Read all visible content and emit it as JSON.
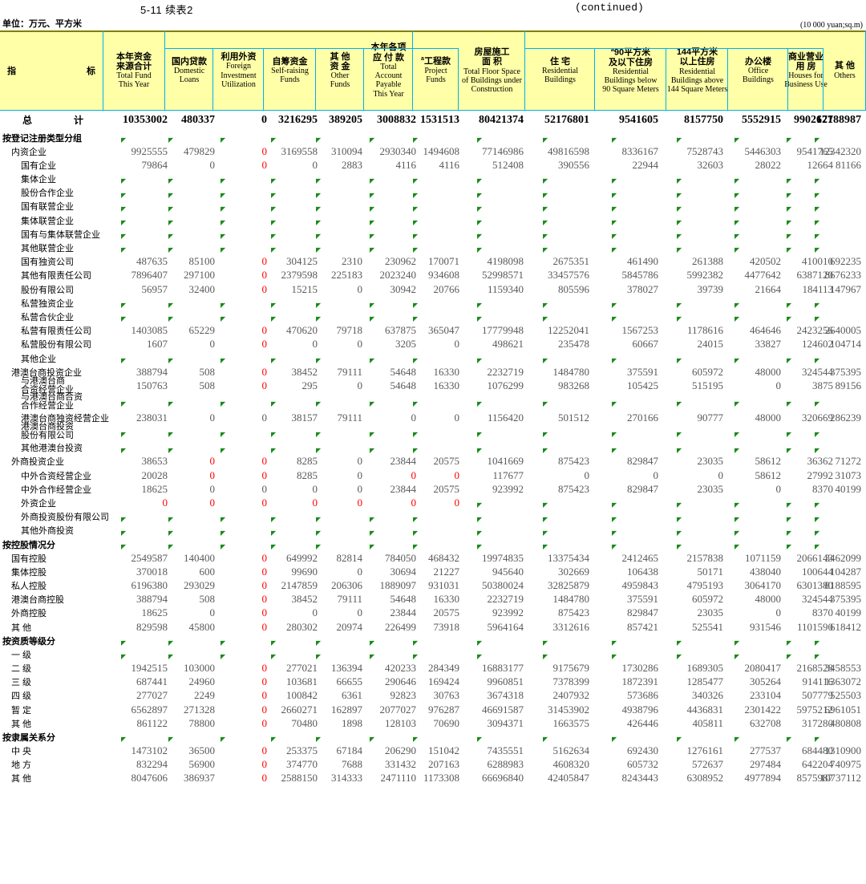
{
  "caption": {
    "table_number": "5-11  续表2",
    "continued": "(continued)",
    "unit_cn": "单位：万元、平方米",
    "unit_en": "(10 000 yuan;sq.m)"
  },
  "stub_header": {
    "left": "指",
    "right": "标"
  },
  "colors": {
    "header_bg": "#ffffa8",
    "grid": "#00b0f0",
    "top_rule": "#808000",
    "value": "#595959",
    "zero_red": "#ff0000",
    "tick": "#1a8a1a"
  },
  "columns": [
    {
      "key": "total_fund",
      "cn": "本年资金\n来源合计",
      "en": "Total Fund\nThis Year"
    },
    {
      "key": "domestic_loans",
      "cn": "国内贷款",
      "en": "Domestic\nLoans"
    },
    {
      "key": "foreign_inv",
      "cn": "利用外资",
      "en": "Foreign\nInvestment\nUtilization"
    },
    {
      "key": "self_raising",
      "cn": "自筹资金",
      "en": "Self-raising\nFunds"
    },
    {
      "key": "other_funds",
      "cn": "其  他\n资  金",
      "en": "Other\nFunds"
    },
    {
      "key": "account_payable",
      "cn": "本年各项\n应 付 款",
      "en": "Total\nAccount\nPayable\nThis Year"
    },
    {
      "key": "project_funds",
      "cn": "工程款",
      "en": "Project\nFunds",
      "sup": "a"
    },
    {
      "key": "total_floor",
      "cn": "房屋施工\n面     积",
      "en": "Total Floor Space\nof Buildings under\nConstruction"
    },
    {
      "key": "residential",
      "cn": "住   宅",
      "en": "Residential\nBuildings"
    },
    {
      "key": "res_below90",
      "cn": "90平方米\n及以下住房",
      "en": "Residential\nBuildings below\n90 Square Meters",
      "sup": "a"
    },
    {
      "key": "res_above144",
      "cn": "144平方米\n以上住房",
      "en": "Residential\nBuildings above\n144 Square Meters"
    },
    {
      "key": "office",
      "cn": "办公楼",
      "en": "Office\nBuildings"
    },
    {
      "key": "business",
      "cn": "商业营业\n用    房",
      "en": "Houses for\nBusiness Use"
    },
    {
      "key": "others",
      "cn": "其  他",
      "en": "Others"
    }
  ],
  "rows": [
    {
      "type": "total",
      "label": [
        "总",
        "计"
      ],
      "values": [
        "10353002",
        "480337",
        "0",
        "3216295",
        "389205",
        "3008832",
        "1531513",
        "80421374",
        "52176801",
        "9541605",
        "8157750",
        "5552915",
        "9902671",
        "12788987"
      ],
      "red": [
        2
      ]
    },
    {
      "type": "group",
      "label": "按登记注册类型分组",
      "values": []
    },
    {
      "type": "data",
      "indent": 1,
      "label": "内资企业",
      "values": [
        "9925555",
        "479829",
        "0",
        "3169558",
        "310094",
        "2930340",
        "1494608",
        "77146986",
        "49816598",
        "8336167",
        "7528743",
        "5446303",
        "9541765",
        "12342320"
      ],
      "red": [
        2
      ]
    },
    {
      "type": "data",
      "indent": 2,
      "label": "国有企业",
      "values": [
        "79864",
        "0",
        "0",
        "0",
        "2883",
        "4116",
        "4116",
        "512408",
        "390556",
        "22944",
        "32603",
        "28022",
        "12664",
        "81166"
      ],
      "red": [
        2
      ]
    },
    {
      "type": "data",
      "indent": 2,
      "label": "集体企业",
      "values": []
    },
    {
      "type": "data",
      "indent": 2,
      "label": "股份合作企业",
      "values": []
    },
    {
      "type": "data",
      "indent": 2,
      "label": "国有联营企业",
      "values": []
    },
    {
      "type": "data",
      "indent": 2,
      "label": "集体联营企业",
      "values": []
    },
    {
      "type": "data",
      "indent": 2,
      "label": "国有与集体联营企业",
      "values": []
    },
    {
      "type": "data",
      "indent": 2,
      "label": "其他联营企业",
      "values": []
    },
    {
      "type": "data",
      "indent": 2,
      "label": "国有独资公司",
      "values": [
        "487635",
        "85100",
        "0",
        "304125",
        "2310",
        "230962",
        "170071",
        "4198098",
        "2675351",
        "461490",
        "261388",
        "420502",
        "410010",
        "692235"
      ],
      "red": [
        2
      ]
    },
    {
      "type": "data",
      "indent": 2,
      "label": "其他有限责任公司",
      "values": [
        "7896407",
        "297100",
        "0",
        "2379598",
        "225183",
        "2023240",
        "934608",
        "52998571",
        "33457576",
        "5845786",
        "5992382",
        "4477642",
        "6387120",
        "8676233"
      ],
      "red": [
        2
      ]
    },
    {
      "type": "data",
      "indent": 2,
      "label": "股份有限公司",
      "values": [
        "56957",
        "32400",
        "0",
        "15215",
        "0",
        "30942",
        "20766",
        "1159340",
        "805596",
        "378027",
        "39739",
        "21664",
        "184113",
        "147967"
      ],
      "red": [
        2
      ]
    },
    {
      "type": "data",
      "indent": 2,
      "label": "私营独资企业",
      "values": []
    },
    {
      "type": "data",
      "indent": 2,
      "label": "私营合伙企业",
      "values": []
    },
    {
      "type": "data",
      "indent": 2,
      "label": "私营有限责任公司",
      "values": [
        "1403085",
        "65229",
        "0",
        "470620",
        "79718",
        "637875",
        "365047",
        "17779948",
        "12252041",
        "1567253",
        "1178616",
        "464646",
        "2423256",
        "2640005"
      ],
      "red": [
        2
      ]
    },
    {
      "type": "data",
      "indent": 2,
      "label": "私营股份有限公司",
      "values": [
        "1607",
        "0",
        "0",
        "0",
        "0",
        "3205",
        "0",
        "498621",
        "235478",
        "60667",
        "24015",
        "33827",
        "124602",
        "104714"
      ],
      "red": [
        2
      ]
    },
    {
      "type": "data",
      "indent": 2,
      "label": "其他企业",
      "values": []
    },
    {
      "type": "data",
      "indent": 1,
      "label": "港澳台商投资企业",
      "values": [
        "388794",
        "508",
        "0",
        "38452",
        "79111",
        "54648",
        "16330",
        "2232719",
        "1484780",
        "375591",
        "605972",
        "48000",
        "324544",
        "375395"
      ],
      "red": [
        2
      ]
    },
    {
      "type": "data",
      "indent": 2,
      "label2": [
        "与港澳台商",
        "合资经营企业"
      ],
      "values": [
        "150763",
        "508",
        "0",
        "295",
        "0",
        "54648",
        "16330",
        "1076299",
        "983268",
        "105425",
        "515195",
        "0",
        "3875",
        "89156"
      ],
      "red": [
        2
      ]
    },
    {
      "type": "data",
      "indent": 2,
      "label2": [
        "与港澳台商合资",
        "合作经营企业"
      ],
      "values": []
    },
    {
      "type": "data",
      "indent": 2,
      "label": "港澳台商独资经营企业",
      "values": [
        "238031",
        "0",
        "0",
        "38157",
        "79111",
        "0",
        "0",
        "1156420",
        "501512",
        "270166",
        "90777",
        "48000",
        "320669",
        "286239"
      ],
      "red": []
    },
    {
      "type": "data",
      "indent": 2,
      "label2": [
        "港澳台商投资",
        "股份有限公司"
      ],
      "values": []
    },
    {
      "type": "data",
      "indent": 2,
      "label": "其他港澳台投资",
      "values": []
    },
    {
      "type": "data",
      "indent": 1,
      "label": "外商投资企业",
      "values": [
        "38653",
        "0",
        "0",
        "8285",
        "0",
        "23844",
        "20575",
        "1041669",
        "875423",
        "829847",
        "23035",
        "58612",
        "36362",
        "71272"
      ],
      "red": [
        1,
        2
      ]
    },
    {
      "type": "data",
      "indent": 2,
      "label": "中外合资经营企业",
      "values": [
        "20028",
        "0",
        "0",
        "8285",
        "0",
        "0",
        "0",
        "117677",
        "0",
        "0",
        "0",
        "58612",
        "27992",
        "31073"
      ],
      "red": [
        1,
        2,
        5,
        6
      ]
    },
    {
      "type": "data",
      "indent": 2,
      "label": "中外合作经营企业",
      "values": [
        "18625",
        "0",
        "0",
        "0",
        "0",
        "23844",
        "20575",
        "923992",
        "875423",
        "829847",
        "23035",
        "0",
        "8370",
        "40199"
      ],
      "red": []
    },
    {
      "type": "data",
      "indent": 2,
      "label": "外资企业",
      "values": [
        "0",
        "0",
        "0",
        "0",
        "0",
        "0",
        "0"
      ],
      "red": [
        0,
        1,
        2,
        3,
        4,
        5,
        6
      ]
    },
    {
      "type": "data",
      "indent": 2,
      "label": "外商投资股份有限公司",
      "values": []
    },
    {
      "type": "data",
      "indent": 2,
      "label": "其他外商投资",
      "values": []
    },
    {
      "type": "group",
      "label": "按控股情况分",
      "values": []
    },
    {
      "type": "data",
      "indent": 1,
      "label": "国有控股",
      "values": [
        "2549587",
        "140400",
        "0",
        "649992",
        "82814",
        "784050",
        "468432",
        "19974835",
        "13375434",
        "2412465",
        "2157838",
        "1071159",
        "2066143",
        "3462099"
      ],
      "red": [
        2
      ]
    },
    {
      "type": "data",
      "indent": 1,
      "label": "集体控股",
      "values": [
        "370018",
        "600",
        "0",
        "99690",
        "0",
        "30694",
        "21227",
        "945640",
        "302669",
        "106438",
        "50171",
        "438040",
        "100644",
        "104287"
      ],
      "red": [
        2
      ]
    },
    {
      "type": "data",
      "indent": 1,
      "label": "私人控股",
      "values": [
        "6196380",
        "293029",
        "0",
        "2147859",
        "206306",
        "1889097",
        "931031",
        "50380024",
        "32825879",
        "4959843",
        "4795193",
        "3064170",
        "6301380",
        "8188595"
      ],
      "red": [
        2
      ]
    },
    {
      "type": "data",
      "indent": 1,
      "label": "港澳台商控股",
      "values": [
        "388794",
        "508",
        "0",
        "38452",
        "79111",
        "54648",
        "16330",
        "2232719",
        "1484780",
        "375591",
        "605972",
        "48000",
        "324544",
        "375395"
      ],
      "red": [
        2
      ]
    },
    {
      "type": "data",
      "indent": 1,
      "label": "外商控股",
      "values": [
        "18625",
        "0",
        "0",
        "0",
        "0",
        "23844",
        "20575",
        "923992",
        "875423",
        "829847",
        "23035",
        "0",
        "8370",
        "40199"
      ],
      "red": [
        2
      ]
    },
    {
      "type": "data",
      "indent": 1,
      "label": "其   他",
      "values": [
        "829598",
        "45800",
        "0",
        "280302",
        "20974",
        "226499",
        "73918",
        "5964164",
        "3312616",
        "857421",
        "525541",
        "931546",
        "1101590",
        "618412"
      ],
      "red": [
        2
      ]
    },
    {
      "type": "group",
      "label": "按资质等级分",
      "values": []
    },
    {
      "type": "data",
      "indent": 1,
      "label": "一    级",
      "values": []
    },
    {
      "type": "data",
      "indent": 1,
      "label": "二    级",
      "values": [
        "1942515",
        "103000",
        "0",
        "277021",
        "136394",
        "420233",
        "284349",
        "16883177",
        "9175679",
        "1730286",
        "1689305",
        "2080417",
        "2168528",
        "3458553"
      ],
      "red": [
        2
      ]
    },
    {
      "type": "data",
      "indent": 1,
      "label": "三    级",
      "values": [
        "687441",
        "24960",
        "0",
        "103681",
        "66655",
        "290646",
        "169424",
        "9960851",
        "7378399",
        "1872391",
        "1285477",
        "305264",
        "914116",
        "1363072"
      ],
      "red": [
        2
      ]
    },
    {
      "type": "data",
      "indent": 1,
      "label": "四    级",
      "values": [
        "277027",
        "2249",
        "0",
        "100842",
        "6361",
        "92823",
        "30763",
        "3674318",
        "2407932",
        "573686",
        "340326",
        "233104",
        "507779",
        "525503"
      ],
      "red": [
        2
      ]
    },
    {
      "type": "data",
      "indent": 1,
      "label": "暂    定",
      "values": [
        "6562897",
        "271328",
        "0",
        "2660271",
        "162897",
        "2077027",
        "976287",
        "46691587",
        "31453902",
        "4938796",
        "4436831",
        "2301422",
        "5975212",
        "6961051"
      ],
      "red": [
        2
      ]
    },
    {
      "type": "data",
      "indent": 1,
      "label": "其    他",
      "values": [
        "861122",
        "78800",
        "0",
        "70480",
        "1898",
        "128103",
        "70690",
        "3094371",
        "1663575",
        "426446",
        "405811",
        "632708",
        "317280",
        "480808"
      ],
      "red": [
        2
      ]
    },
    {
      "type": "group",
      "label": "按隶属关系分",
      "values": []
    },
    {
      "type": "data",
      "indent": 1,
      "label": "中    央",
      "values": [
        "1473102",
        "36500",
        "0",
        "253375",
        "67184",
        "206290",
        "151042",
        "7435551",
        "5162634",
        "692430",
        "1276161",
        "277537",
        "684480",
        "1310900"
      ],
      "red": [
        2
      ]
    },
    {
      "type": "data",
      "indent": 1,
      "label": "地    方",
      "values": [
        "832294",
        "56900",
        "0",
        "374770",
        "7688",
        "331432",
        "207163",
        "6288983",
        "4608320",
        "605732",
        "572637",
        "297484",
        "642204",
        "740975"
      ],
      "red": [
        2
      ]
    },
    {
      "type": "data",
      "indent": 1,
      "label": "其    他",
      "values": [
        "8047606",
        "386937",
        "0",
        "2588150",
        "314333",
        "2471110",
        "1173308",
        "66696840",
        "42405847",
        "8243443",
        "6308952",
        "4977894",
        "8575987",
        "10737112"
      ],
      "red": [
        2
      ]
    }
  ]
}
